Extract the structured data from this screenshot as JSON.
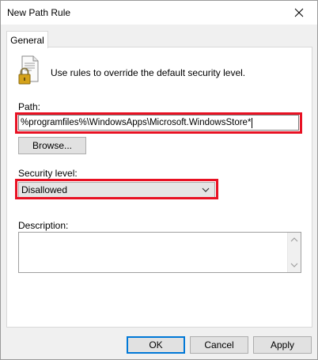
{
  "window": {
    "title": "New Path Rule"
  },
  "tabs": [
    {
      "label": "General",
      "selected": true
    }
  ],
  "intro_text": "Use rules to override the default security level.",
  "path": {
    "label": "Path:",
    "value": "%programfiles%\\WindowsApps\\Microsoft.WindowsStore*",
    "highlighted": true
  },
  "browse_label": "Browse...",
  "security": {
    "label": "Security level:",
    "selected": "Disallowed",
    "highlighted": true
  },
  "description": {
    "label": "Description:",
    "value": ""
  },
  "footer": {
    "ok_label": "OK",
    "cancel_label": "Cancel",
    "apply_label": "Apply"
  },
  "icons": {
    "close": "close-icon",
    "document_lock": "document-lock-icon",
    "dropdown": "chevron-down-icon",
    "scroll_up": "scroll-up-icon",
    "scroll_down": "scroll-down-icon"
  },
  "colors": {
    "highlight": "#e81123",
    "default_button_border": "#0078d7",
    "dialog_bg": "#f0f0f0"
  }
}
